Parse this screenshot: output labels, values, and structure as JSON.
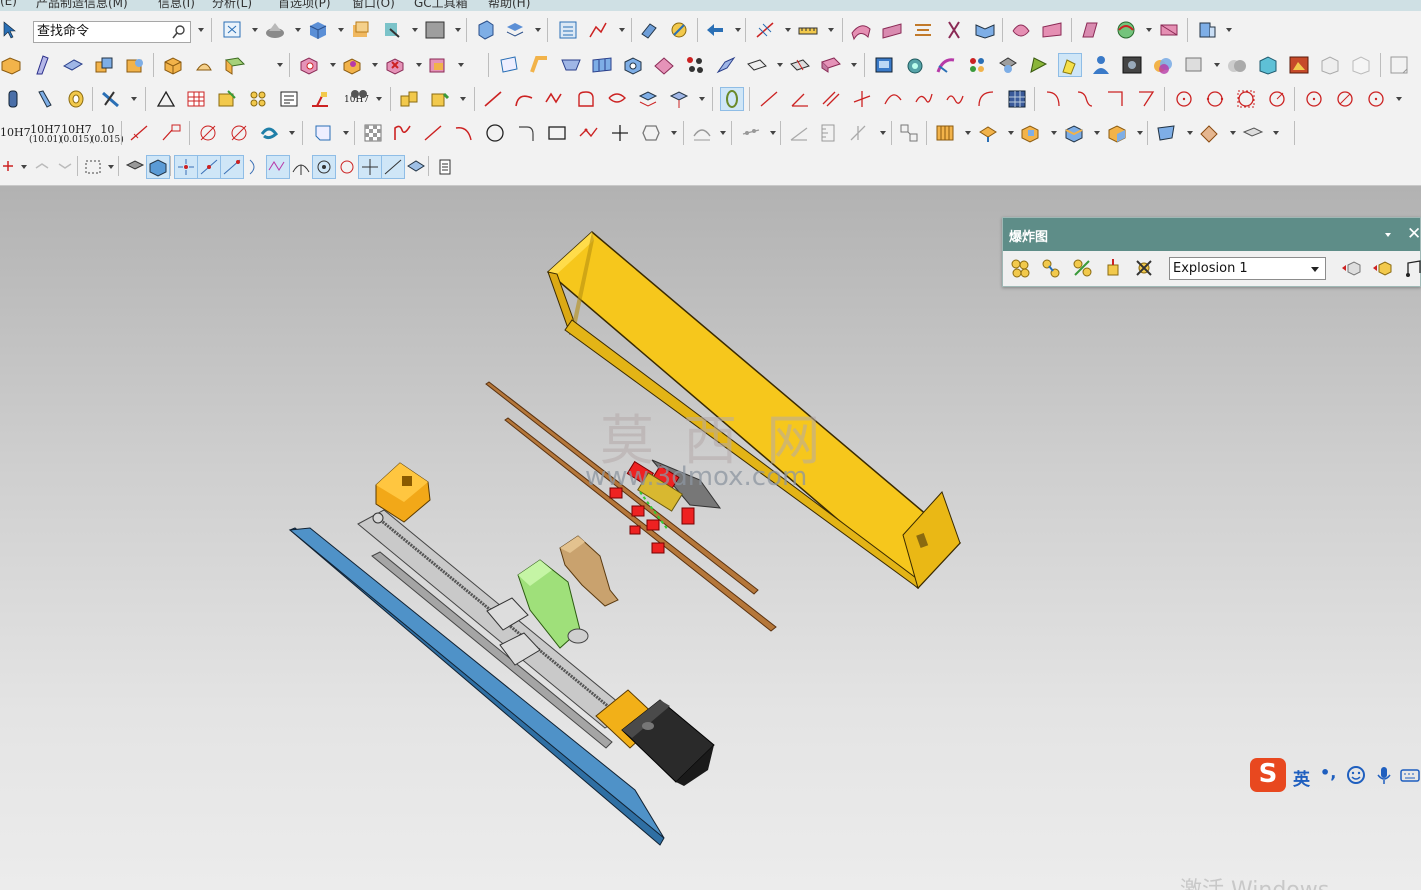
{
  "menubar": {
    "items": [
      "(E)",
      "产品制造信息(M)",
      "信息(I)",
      "分析(L)",
      "首选项(P)",
      "窗口(O)",
      "GC工具箱",
      "帮助(H)"
    ]
  },
  "toolbar": {
    "search_placeholder": "查找命令",
    "tolerance_labels": [
      {
        "main": "10H7",
        "sub": ""
      },
      {
        "main": "10H7",
        "sub": "(10.01)"
      },
      {
        "main": "10H7",
        "sub": "(0.015)"
      },
      {
        "main": "10",
        "sub": "(0.015)"
      }
    ],
    "fit_label": "10H7"
  },
  "explosion_panel": {
    "title": "爆炸图",
    "selected": "Explosion 1",
    "tool_icons": [
      "create-explosion-icon",
      "edit-explosion-icon",
      "auto-explode-icon",
      "unexplode-component-icon",
      "delete-explosion-icon",
      "hide-in-view-icon",
      "show-in-view-icon",
      "tracelines-icon"
    ]
  },
  "watermark": {
    "title": "莫 西 网",
    "url": "www.3dmox.com"
  },
  "ime": {
    "logo": "S",
    "language": "英",
    "punctuation": "•,"
  },
  "os_notice": "激活 Windows",
  "colors": {
    "accent_panel": "#5e8d88",
    "frame_yellow": "#f5c518",
    "plate_blue": "#3b7fb0",
    "toolbar_bg": "#f2f2f2"
  }
}
